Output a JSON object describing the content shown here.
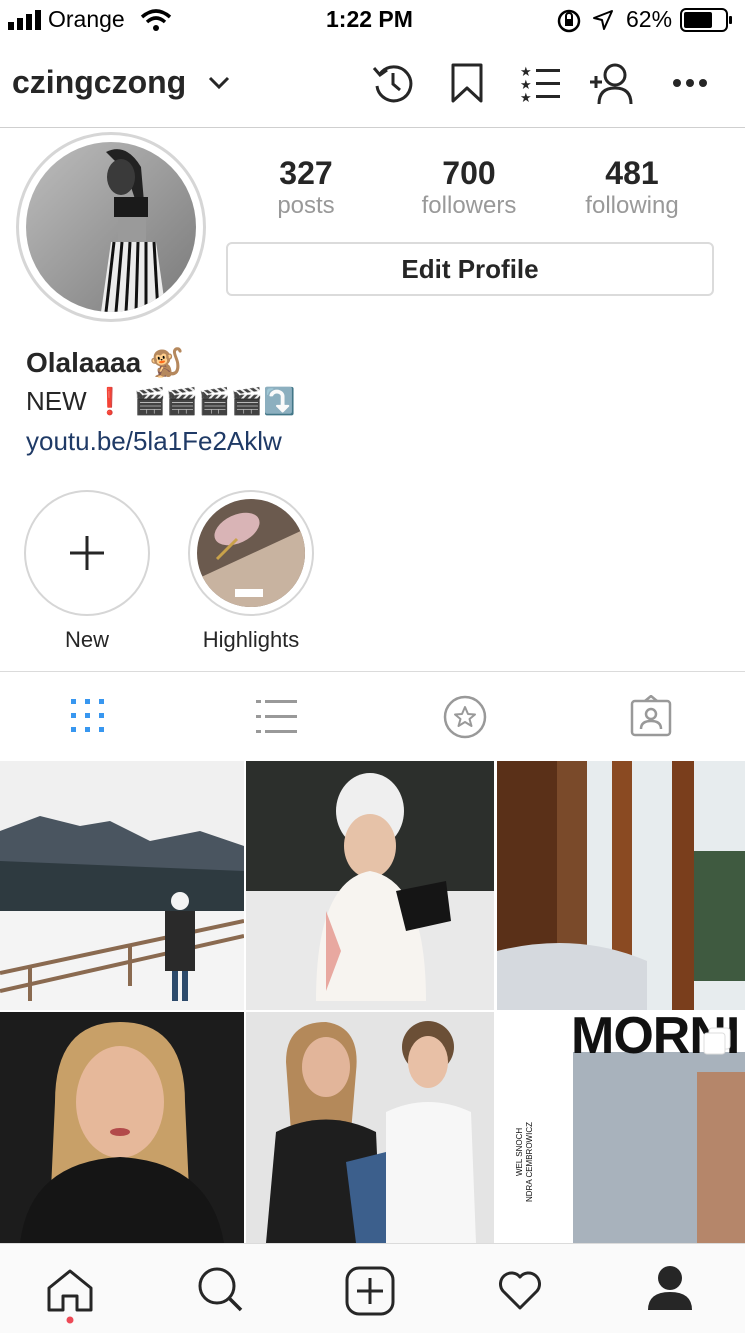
{
  "status_bar": {
    "carrier": "Orange",
    "time": "1:22 PM",
    "battery_pct": "62%"
  },
  "header": {
    "username": "czingczong"
  },
  "profile": {
    "stats": [
      {
        "value": "327",
        "label": "posts"
      },
      {
        "value": "700",
        "label": "followers"
      },
      {
        "value": "481",
        "label": "following"
      }
    ],
    "edit_label": "Edit Profile",
    "bio_name": "Olalaaaa 🐒",
    "bio_line": "NEW ❗ 🎬🎬🎬🎬⤵️",
    "bio_link": "youtu.be/5la1Fe2Aklw"
  },
  "highlights": [
    {
      "label": "New"
    },
    {
      "label": "Highlights"
    }
  ],
  "grid_overlay": {
    "morning_text": "MORNI",
    "credit_1": "WEL SNOCH",
    "credit_2": "NDRA CEMBROWICZ"
  },
  "colors": {
    "active_tab": "#3897f0",
    "link": "#1f3a66",
    "notification_dot": "#ed4956"
  }
}
